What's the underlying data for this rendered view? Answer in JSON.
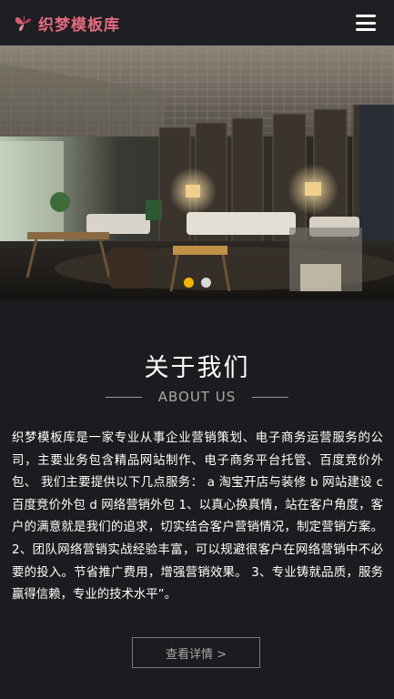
{
  "header": {
    "logo_text": "织梦模板库",
    "logo_icon": "butterfly-icon",
    "menu_icon": "hamburger-menu-icon"
  },
  "banner": {
    "slide_count": 2,
    "active_slide": 1,
    "active_dot_color": "#f5b400",
    "inactive_dot_color": "#d8d8d8"
  },
  "about": {
    "title": "关于我们",
    "subtitle": "ABOUT US",
    "description": "织梦模板库是一家专业从事企业营销策划、电子商务运营服务的公司，主要业务包含精品网站制作、电子商务平台托管、百度竞价外包、 我们主要提供以下几点服务： a 淘宝开店与装修 b 网站建设 c 百度竞价外包 d 网络营销外包 1、以真心换真情，站在客户角度，客户的满意就是我们的追求，切实结合客户营销情况，制定营销方案。 2、团队网络营销实战经验丰富，可以规避很客户在网络营销中不必要的投入。节省推广费用，增强营销效果。 3、专业铸就品质，服务赢得信赖，专业的技术水平”。",
    "more_label": "查看详情 >"
  },
  "colors": {
    "brand": "#e46a7e",
    "background": "#1b1c1f"
  }
}
